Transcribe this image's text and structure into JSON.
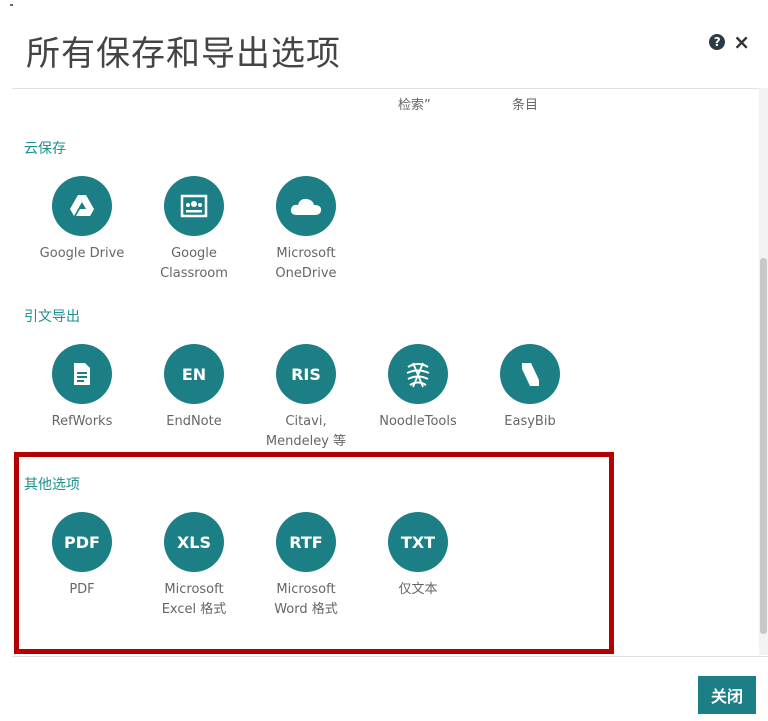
{
  "dialog": {
    "title": "所有保存和导出选项",
    "help_icon": "?",
    "close_icon": "×"
  },
  "top_labels": [
    "检索”",
    "条目"
  ],
  "sections": {
    "cloud": {
      "label": "云保存",
      "items": [
        {
          "label": "Google Drive",
          "icon": "google-drive-icon"
        },
        {
          "label": "Google\nClassroom",
          "icon": "google-classroom-icon"
        },
        {
          "label": "Microsoft\nOneDrive",
          "icon": "onedrive-icon"
        }
      ]
    },
    "citation": {
      "label": "引文导出",
      "items": [
        {
          "label": "RefWorks",
          "icon": "refworks-icon"
        },
        {
          "label": "EndNote",
          "icon_text": "EN"
        },
        {
          "label": "Citavi,\nMendeley 等",
          "icon_text": "RIS"
        },
        {
          "label": "NoodleTools",
          "icon": "noodletools-icon"
        },
        {
          "label": "EasyBib",
          "icon": "easybib-icon"
        }
      ]
    },
    "other": {
      "label": "其他选项",
      "items": [
        {
          "label": "PDF",
          "icon_text": "PDF"
        },
        {
          "label": "Microsoft\nExcel 格式",
          "icon_text": "XLS"
        },
        {
          "label": "Microsoft\nWord 格式",
          "icon_text": "RTF"
        },
        {
          "label": "仅文本",
          "icon_text": "TXT"
        }
      ]
    }
  },
  "footer": {
    "close_label": "关闭"
  },
  "colors": {
    "accent": "#1d7f86",
    "highlight": "#b40000"
  }
}
